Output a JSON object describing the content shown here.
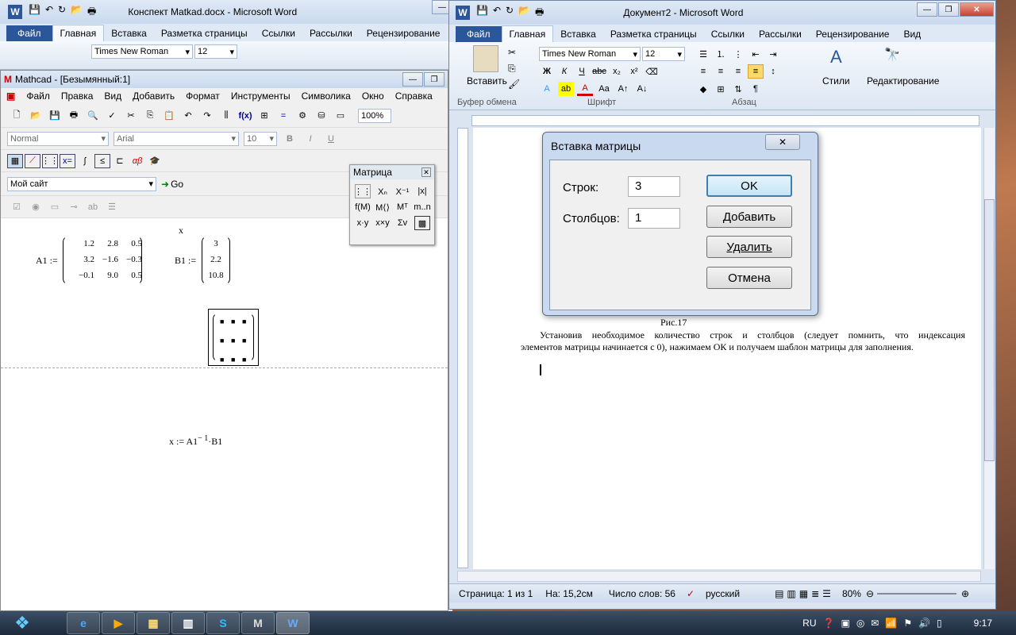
{
  "left_word": {
    "title": "Конспект Matkad.docx - Microsoft Word",
    "tabs": [
      "Файл",
      "Главная",
      "Вставка",
      "Разметка страницы",
      "Ссылки",
      "Рассылки",
      "Рецензирование"
    ],
    "font": "Times New Roman",
    "size": "12"
  },
  "mathcad": {
    "title": "Mathcad - [Безымянный:1]",
    "menu": [
      "Файл",
      "Правка",
      "Вид",
      "Добавить",
      "Формат",
      "Инструменты",
      "Символика",
      "Окно",
      "Справка"
    ],
    "zoom": "100%",
    "style": "Normal",
    "font": "Arial",
    "size": "10",
    "site": "Мой сайт",
    "go": "Go",
    "palette_title": "Матрица",
    "x_label": "x",
    "a1_label": "A1 :=",
    "a1": [
      "1.2",
      "2.8",
      "0.5",
      "3.2",
      "−1.6",
      "−0.3",
      "−0.1",
      "9.0",
      "0.5"
    ],
    "b1_label": "B1 :=",
    "b1": [
      "3",
      "2.2",
      "10.8"
    ],
    "formula": "x := A1",
    "formula_sup": "− 1",
    "formula_tail": "·B1"
  },
  "right_word": {
    "title": "Документ2 - Microsoft Word",
    "tabs": [
      "Файл",
      "Главная",
      "Вставка",
      "Разметка страницы",
      "Ссылки",
      "Рассылки",
      "Рецензирование",
      "Вид"
    ],
    "font": "Times New Roman",
    "size": "12",
    "groups": [
      "Буфер обмена",
      "Шрифт",
      "Абзац"
    ],
    "paste": "Вставить",
    "styles": "Стили",
    "editing": "Редактирование",
    "caption": "Рис.17",
    "para_line1": "Установив необходимое количество строк и столбцов (следует помнить, что индексация",
    "para_line2": "элементов матрицы начинается с 0), нажимаем ОК и получаем шаблон матрицы для заполнения.",
    "status": {
      "page": "Страница: 1 из 1",
      "pos": "На: 15,2см",
      "words": "Число слов: 56",
      "lang": "русский",
      "zoom": "80%"
    }
  },
  "dialog": {
    "title": "Вставка матрицы",
    "rows_label": "Строк:",
    "rows": "3",
    "cols_label": "Столбцов:",
    "cols": "1",
    "ok": "OK",
    "add": "Добавить",
    "delete": "Удалить",
    "cancel": "Отмена"
  },
  "taskbar": {
    "lang": "RU",
    "time": "9:17"
  }
}
